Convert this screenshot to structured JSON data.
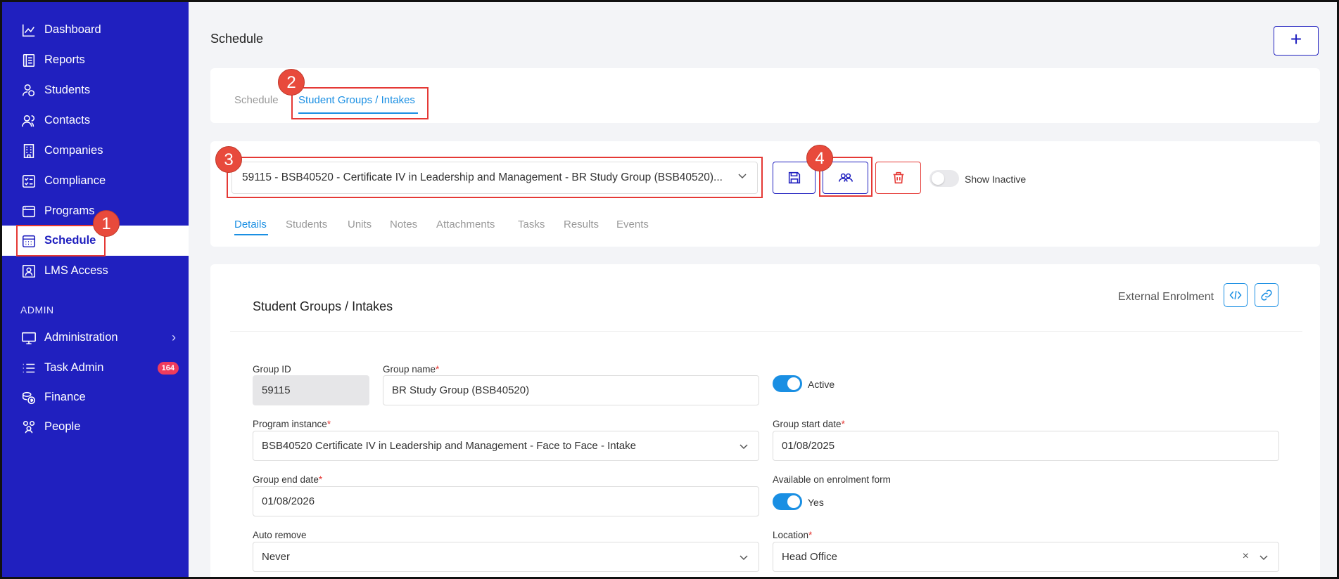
{
  "sidebar": {
    "items": [
      {
        "label": "Dashboard",
        "icon": "chart-line-icon"
      },
      {
        "label": "Reports",
        "icon": "report-icon"
      },
      {
        "label": "Students",
        "icon": "students-icon"
      },
      {
        "label": "Contacts",
        "icon": "contacts-icon"
      },
      {
        "label": "Companies",
        "icon": "building-icon"
      },
      {
        "label": "Compliance",
        "icon": "checklist-icon"
      },
      {
        "label": "Programs",
        "icon": "programs-icon"
      },
      {
        "label": "Schedule",
        "icon": "calendar-grid-icon",
        "active": true
      },
      {
        "label": "LMS Access",
        "icon": "lms-user-icon"
      }
    ],
    "admin_label": "ADMIN",
    "admin_items": [
      {
        "label": "Administration",
        "icon": "monitor-icon"
      },
      {
        "label": "Task Admin",
        "icon": "list-icon",
        "badge": "164"
      },
      {
        "label": "Finance",
        "icon": "coins-icon"
      },
      {
        "label": "People",
        "icon": "people-icon"
      }
    ]
  },
  "header": {
    "title": "Schedule",
    "add_label": "+"
  },
  "tabs": [
    {
      "label": "Schedule"
    },
    {
      "label": "Student Groups / Intakes",
      "active": true
    }
  ],
  "group_selector": {
    "value": "59115 - BSB40520 - Certificate IV in Leadership and Management - BR Study Group (BSB40520)..."
  },
  "show_inactive_label": "Show Inactive",
  "subtabs": [
    "Details",
    "Students",
    "Units",
    "Notes",
    "Attachments",
    "Tasks",
    "Results",
    "Events"
  ],
  "markers": [
    "1",
    "2",
    "3",
    "4"
  ],
  "form": {
    "section_title": "Student Groups / Intakes",
    "external_enrolment_label": "External Enrolment",
    "group_id_label": "Group ID",
    "group_id_value": "59115",
    "group_name_label": "Group name",
    "group_name_value": "BR Study Group (BSB40520)",
    "active_label": "Active",
    "program_instance_label": "Program instance",
    "program_instance_value": "BSB40520 Certificate IV in Leadership and Management - Face to Face - Intake",
    "start_date_label": "Group start date",
    "start_date_value": "01/08/2025",
    "end_date_label": "Group end date",
    "end_date_value": "01/08/2026",
    "available_label": "Available on enrolment form",
    "available_value": "Yes",
    "auto_remove_label": "Auto remove",
    "auto_remove_value": "Never",
    "location_label": "Location",
    "location_value": "Head Office",
    "required_mark": "*"
  },
  "colors": {
    "sidebar": "#2020bf",
    "accent": "#1a8fe3",
    "highlight": "#e53935",
    "danger": "#e53935"
  }
}
